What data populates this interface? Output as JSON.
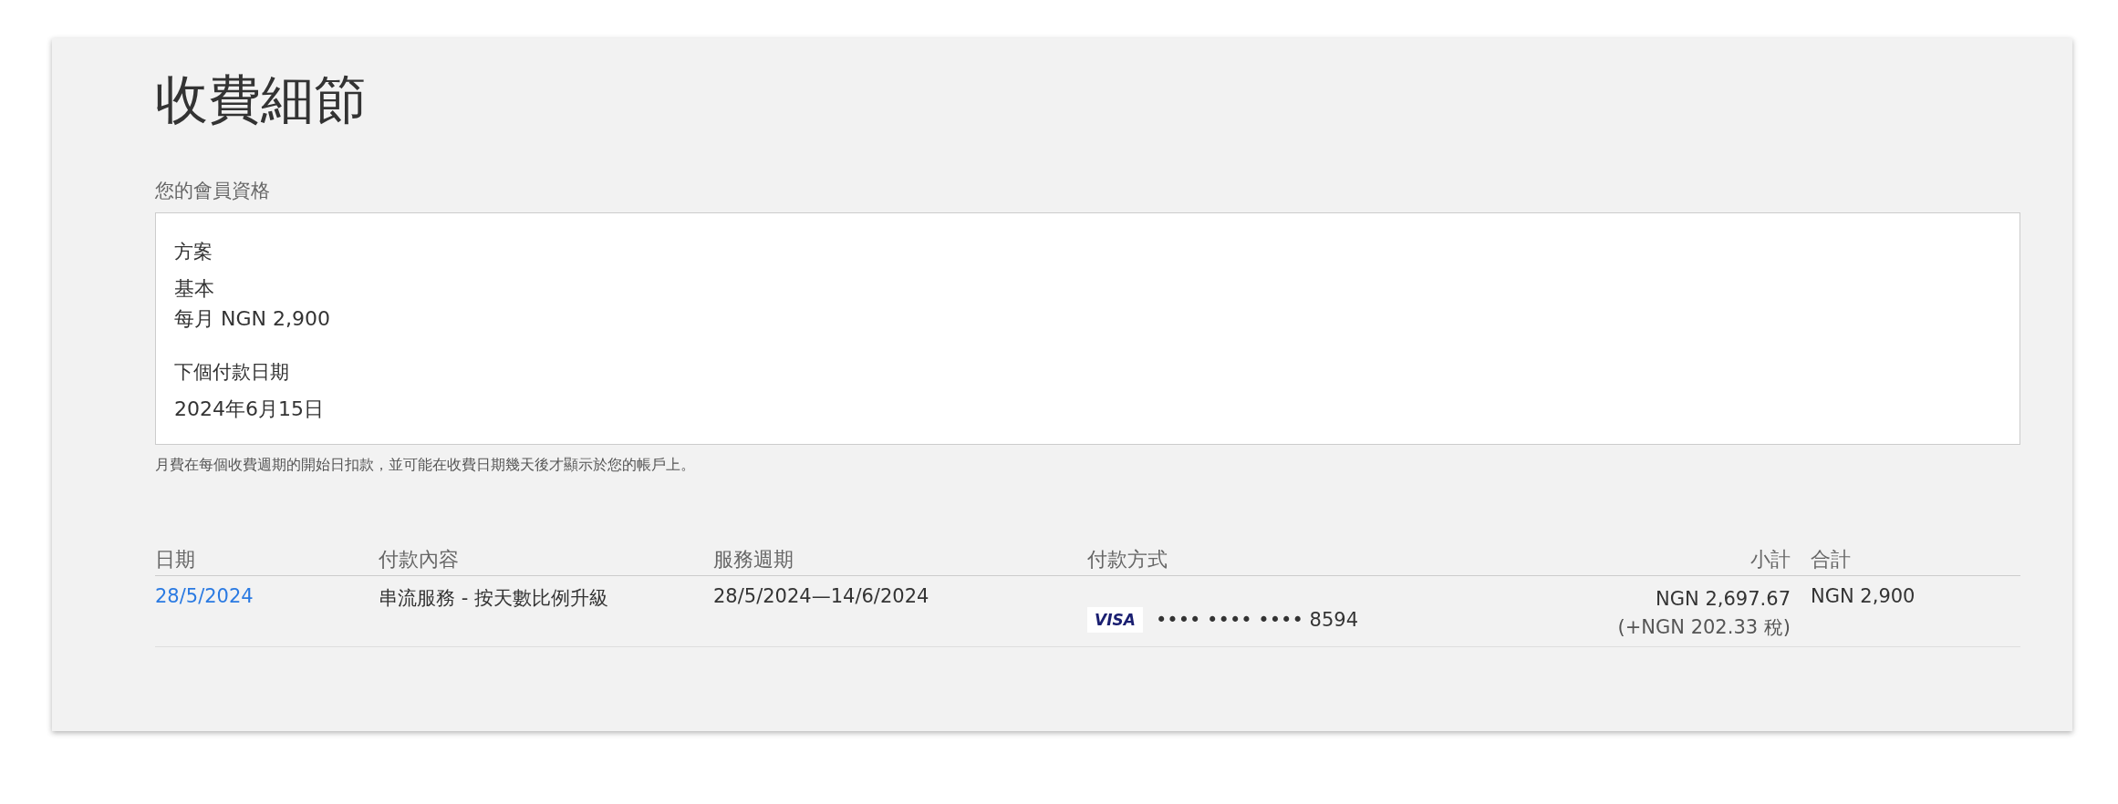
{
  "title": "收費細節",
  "membership": {
    "heading": "您的會員資格",
    "plan_label": "方案",
    "plan_name": "基本",
    "plan_price": "每月 NGN 2,900",
    "next_label": "下個付款日期",
    "next_date": "2024年6月15日"
  },
  "note": "月費在每個收費週期的開始日扣款，並可能在收費日期幾天後才顯示於您的帳戶上。",
  "table": {
    "columns": [
      "日期",
      "付款內容",
      "服務週期",
      "付款方式",
      "小計",
      "合計"
    ],
    "rows": [
      {
        "date": "28/5/2024",
        "description": "串流服務 - 按天數比例升級",
        "period": "28/5/2024—14/6/2024",
        "card_brand": "VISA",
        "card_number": "•••• •••• •••• 8594",
        "subtotal": "NGN 2,697.67",
        "tax": "(+NGN 202.33 稅)",
        "total": "NGN 2,900"
      }
    ]
  }
}
